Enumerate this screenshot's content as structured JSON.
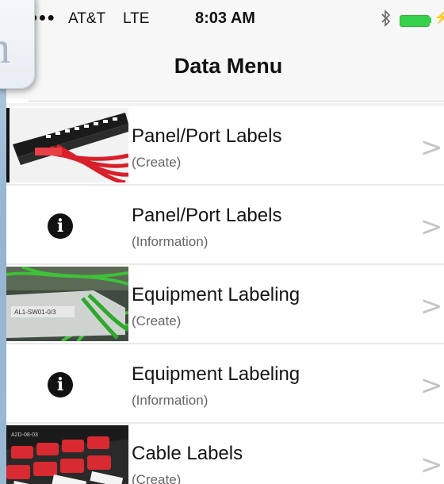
{
  "status_bar": {
    "signal_icon": "signal-dots-icon",
    "carrier": "AT&T",
    "network": "LTE",
    "time": "8:03 AM",
    "bluetooth_icon": "bluetooth-icon",
    "battery_icon": "battery-charging-icon",
    "battery_color": "#36d04a"
  },
  "nav": {
    "title": "Data Menu"
  },
  "overlay": {
    "glyph": "n"
  },
  "menu_items": [
    {
      "title": "Panel/Port Labels",
      "subtitle": "(Create)",
      "icon": "patch-panel-photo"
    },
    {
      "title": "Panel/Port Labels",
      "subtitle": "(Information)",
      "icon": "info-icon"
    },
    {
      "title": "Equipment Labeling",
      "subtitle": "(Create)",
      "icon": "equipment-photo"
    },
    {
      "title": "Equipment Labeling",
      "subtitle": "(Information)",
      "icon": "info-icon"
    },
    {
      "title": "Cable Labels",
      "subtitle": "(Create)",
      "icon": "cable-labels-photo"
    }
  ],
  "chevron_glyph": ">",
  "info_glyph": "i"
}
